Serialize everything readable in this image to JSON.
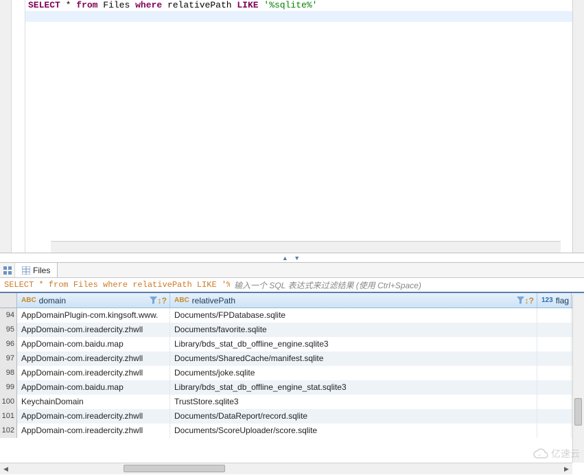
{
  "editor": {
    "sql_tokens": [
      {
        "t": "SELECT",
        "c": "kw"
      },
      {
        "t": " ",
        "c": ""
      },
      {
        "t": "*",
        "c": "cm-op"
      },
      {
        "t": " ",
        "c": ""
      },
      {
        "t": "from",
        "c": "kw"
      },
      {
        "t": " ",
        "c": ""
      },
      {
        "t": "Files",
        "c": "cm-id"
      },
      {
        "t": " ",
        "c": ""
      },
      {
        "t": "where",
        "c": "kw"
      },
      {
        "t": " ",
        "c": ""
      },
      {
        "t": "relativePath",
        "c": "cm-id"
      },
      {
        "t": " ",
        "c": ""
      },
      {
        "t": "LIKE",
        "c": "kw"
      },
      {
        "t": " ",
        "c": ""
      },
      {
        "t": "'%sqlite%'",
        "c": "cm-str"
      }
    ]
  },
  "sash_arrows": "▲ ▼",
  "tabs": {
    "active": "Files"
  },
  "statusbar": {
    "sql_display": "SELECT * from Files where relativePath LIKE '%sq",
    "filter_hint": "输入一个 SQL 表达式来过滤结果 (使用 Ctrl+Space)"
  },
  "columns": [
    {
      "name": "domain",
      "label": "domain",
      "type": "ABC"
    },
    {
      "name": "relativePath",
      "label": "relativePath",
      "type": "ABC"
    },
    {
      "name": "flag",
      "label": "flag",
      "type": "123"
    }
  ],
  "rows": [
    {
      "n": 94,
      "domain": "AppDomainPlugin-com.kingsoft.www.",
      "rel": "Documents/FPDatabase.sqlite"
    },
    {
      "n": 95,
      "domain": "AppDomain-com.ireadercity.zhwll",
      "rel": "Documents/favorite.sqlite"
    },
    {
      "n": 96,
      "domain": "AppDomain-com.baidu.map",
      "rel": "Library/bds_stat_db_offline_engine.sqlite3"
    },
    {
      "n": 97,
      "domain": "AppDomain-com.ireadercity.zhwll",
      "rel": "Documents/SharedCache/manifest.sqlite"
    },
    {
      "n": 98,
      "domain": "AppDomain-com.ireadercity.zhwll",
      "rel": "Documents/joke.sqlite"
    },
    {
      "n": 99,
      "domain": "AppDomain-com.baidu.map",
      "rel": "Library/bds_stat_db_offline_engine_stat.sqlite3"
    },
    {
      "n": 100,
      "domain": "KeychainDomain",
      "rel": "TrustStore.sqlite3"
    },
    {
      "n": 101,
      "domain": "AppDomain-com.ireadercity.zhwll",
      "rel": "Documents/DataReport/record.sqlite"
    },
    {
      "n": 102,
      "domain": "AppDomain-com.ireadercity.zhwll",
      "rel": "Documents/ScoreUploader/score.sqlite"
    }
  ],
  "watermark": "亿速云"
}
